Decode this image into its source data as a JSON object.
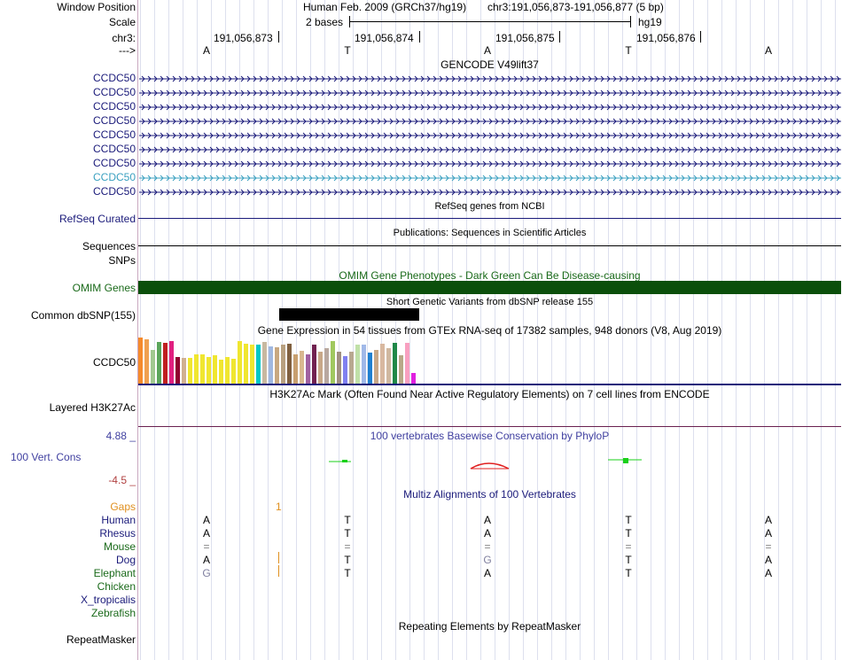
{
  "header": {
    "labels": {
      "window_position": "Window Position",
      "scale": "Scale",
      "chr": "chr3:",
      "strand": "--->"
    },
    "assembly_text": "Human Feb. 2009 (GRCh37/hg19)",
    "position_text": "chr3:191,056,873-191,056,877 (5 bp)",
    "scale_text": "2 bases",
    "scale_db": "hg19",
    "coords": [
      "191,056,873",
      "191,056,874",
      "191,056,875",
      "191,056,876"
    ],
    "bases": [
      "A",
      "T",
      "A",
      "T",
      "A"
    ]
  },
  "gencode": {
    "title": "GENCODE V49lift37",
    "genes": [
      "CCDC50",
      "CCDC50",
      "CCDC50",
      "CCDC50",
      "CCDC50",
      "CCDC50",
      "CCDC50",
      "CCDC50",
      "CCDC50"
    ],
    "colors": {
      "gene": "#1a1a7a",
      "highlight": "#3aa0c0"
    }
  },
  "refseq": {
    "title": "RefSeq genes from NCBI",
    "label": "RefSeq Curated"
  },
  "publications": {
    "title": "Publications: Sequences in Scientific Articles",
    "label": "Sequences",
    "snps_label": "SNPs"
  },
  "omim": {
    "title": "OMIM Gene Phenotypes - Dark Green Can Be Disease-causing",
    "label": "OMIM Genes",
    "color": "#0b4f0b"
  },
  "dbsnp": {
    "title": "Short Genetic Variants from dbSNP release 155",
    "label": "Common dbSNP(155)"
  },
  "gtex": {
    "title": "Gene Expression in 54 tissues from GTEx RNA-seq of 17382 samples, 948 donors (V8, Aug 2019)",
    "label": "CCDC50",
    "chart_data": {
      "type": "bar",
      "values": [
        52,
        50,
        38,
        47,
        46,
        48,
        30,
        29,
        29,
        33,
        33,
        30,
        32,
        27,
        30,
        28,
        48,
        45,
        44,
        44,
        47,
        42,
        41,
        44,
        45,
        33,
        37,
        33,
        44,
        36,
        40,
        48,
        36,
        31,
        36,
        44,
        44,
        35,
        38,
        45,
        40,
        46,
        32,
        46,
        12
      ],
      "colors": [
        "#f58a2c",
        "#f0a050",
        "#a0c890",
        "#5aa55a",
        "#c02020",
        "#e02080",
        "#900030",
        "#d0b090",
        "#f0e630",
        "#f0e630",
        "#f0e630",
        "#f0e630",
        "#f0e630",
        "#f0e630",
        "#f0e630",
        "#f0e630",
        "#f0e630",
        "#f0e630",
        "#f0e630",
        "#00c8c8",
        "#c8b8a0",
        "#a0b8e0",
        "#c8a880",
        "#b8a080",
        "#806040",
        "#c8a070",
        "#d8b890",
        "#a060a0",
        "#702050",
        "#c8a888",
        "#b8a8a0",
        "#a0c860",
        "#a09080",
        "#8080f0",
        "#b8a890",
        "#c0e0a8",
        "#a0b8e8",
        "#2080d0",
        "#c8a888",
        "#d8b8a0",
        "#d0b8a0",
        "#208848",
        "#b8a888",
        "#f8a0c0",
        "#e020e0"
      ]
    }
  },
  "h3k27ac": {
    "title": "H3K27Ac Mark (Often Found Near Active Regulatory Elements) on 7 cell lines from ENCODE",
    "label": "Layered H3K27Ac"
  },
  "conservation": {
    "title": "100 vertebrates Basewise Conservation by PhyloP",
    "label": "100 Vert. Cons",
    "y_max": "4.88 _",
    "y_min": "-4.5 _",
    "colors": {
      "pos": "#1ad01a",
      "neg": "#e02020",
      "label": "#4040a0",
      "ymin": "#b04040"
    }
  },
  "multiz": {
    "title": "Multiz Alignments of 100 Vertebrates",
    "gaps_label": "Gaps",
    "gaps_value": "1",
    "species": [
      {
        "name": "Human",
        "color": "#1a1a7a",
        "bases": [
          "A",
          "T",
          "A",
          "T",
          "A"
        ],
        "base_color": "#000"
      },
      {
        "name": "Rhesus",
        "color": "#1a1a7a",
        "bases": [
          "A",
          "T",
          "A",
          "T",
          "A"
        ],
        "base_color": "#000"
      },
      {
        "name": "Mouse",
        "color": "#1a6a1a",
        "bases": [
          "=",
          "=",
          "=",
          "=",
          "="
        ],
        "base_color": "#888"
      },
      {
        "name": "Dog",
        "color": "#1a1a7a",
        "bases": [
          "A",
          "T",
          "G",
          "T",
          "A"
        ],
        "base_color": "#000"
      },
      {
        "name": "Elephant",
        "color": "#1a6a1a",
        "bases": [
          "G",
          "T",
          "A",
          "T",
          "A"
        ],
        "base_color": "#000"
      },
      {
        "name": "Chicken",
        "color": "#1a6a1a",
        "bases": [
          "",
          "",
          "",
          "",
          ""
        ],
        "base_color": "#000"
      },
      {
        "name": "X_tropicalis",
        "color": "#1a1a7a",
        "bases": [
          "",
          "",
          "",
          "",
          ""
        ],
        "base_color": "#000"
      },
      {
        "name": "Zebrafish",
        "color": "#1a6a1a",
        "bases": [
          "",
          "",
          "",
          "",
          ""
        ],
        "base_color": "#000"
      }
    ]
  },
  "repeatmasker": {
    "title": "Repeating Elements by RepeatMasker",
    "label": "RepeatMasker"
  }
}
